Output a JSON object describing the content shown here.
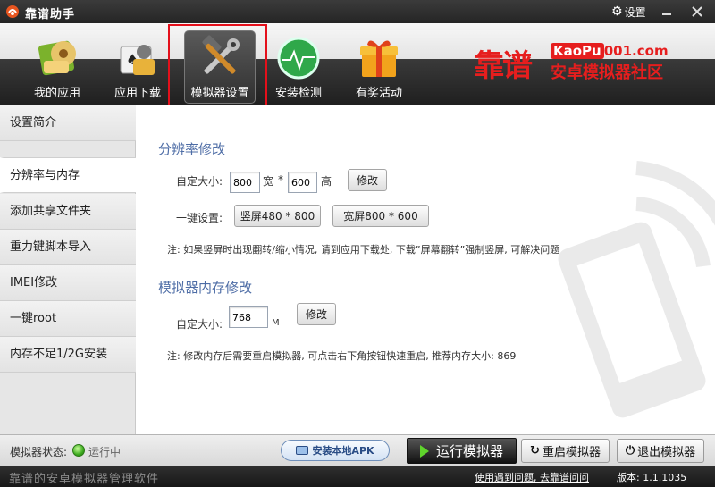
{
  "window": {
    "title": "靠谱助手",
    "settings_label": "设置",
    "icons": {
      "app": "app-logo-icon",
      "settings": "gear-icon",
      "minimize": "minimize-icon",
      "close": "close-icon"
    }
  },
  "toolbar": {
    "items": [
      {
        "label": "我的应用",
        "icon": "my-apps-icon",
        "selected": false
      },
      {
        "label": "应用下载",
        "icon": "app-download-icon",
        "selected": false
      },
      {
        "label": "模拟器设置",
        "icon": "emulator-settings-icon",
        "selected": true
      },
      {
        "label": "安装检测",
        "icon": "install-check-icon",
        "selected": false
      },
      {
        "label": "有奖活动",
        "icon": "gift-icon",
        "selected": false
      }
    ],
    "highlight_color": "#e4101b"
  },
  "logo": {
    "big": "靠谱",
    "url_prefix": "KaoPu",
    "url_suffix": "001.com",
    "subtitle": "安卓模拟器社区",
    "color": "#e61e1e"
  },
  "sidebar": {
    "items": [
      {
        "label": "设置简介",
        "active": false
      },
      {
        "label": "分辨率与内存",
        "active": true
      },
      {
        "label": "添加共享文件夹",
        "active": false
      },
      {
        "label": "重力键脚本导入",
        "active": false
      },
      {
        "label": "IMEI修改",
        "active": false
      },
      {
        "label": "一键root",
        "active": false
      },
      {
        "label": "内存不足1/2G安装",
        "active": false
      }
    ]
  },
  "resolution": {
    "title": "分辨率修改",
    "custom_label": "自定大小:",
    "width_value": "800",
    "width_unit": "宽",
    "times": "*",
    "height_value": "600",
    "height_unit": "高",
    "modify_button": "修改",
    "quick_label": "一键设置:",
    "portrait_button": "竖屏480 * 800",
    "landscape_button": "宽屏800 * 600",
    "note": "注: 如果竖屏时出现翻转/缩小情况, 请到应用下载处, 下载”屏幕翻转”强制竖屏, 可解决问题"
  },
  "memory": {
    "title": "模拟器内存修改",
    "custom_label": "自定大小:",
    "value": "768",
    "unit": "M",
    "modify_button": "修改",
    "note": "注: 修改内存后需要重启模拟器, 可点击右下角按钮快速重启, 推荐内存大小: 869"
  },
  "statusbar": {
    "status_label": "模拟器状态:",
    "status_text": "运行中",
    "status_color": "#3dab1f",
    "install_apk": "安装本地APK",
    "run": "运行模拟器",
    "restart": "重启模拟器",
    "exit": "退出模拟器"
  },
  "footer": {
    "slogan": "靠谱的安卓模拟器管理软件",
    "help_link": "使用遇到问题, 去靠谱问问",
    "version": "版本: 1.1.1035"
  }
}
